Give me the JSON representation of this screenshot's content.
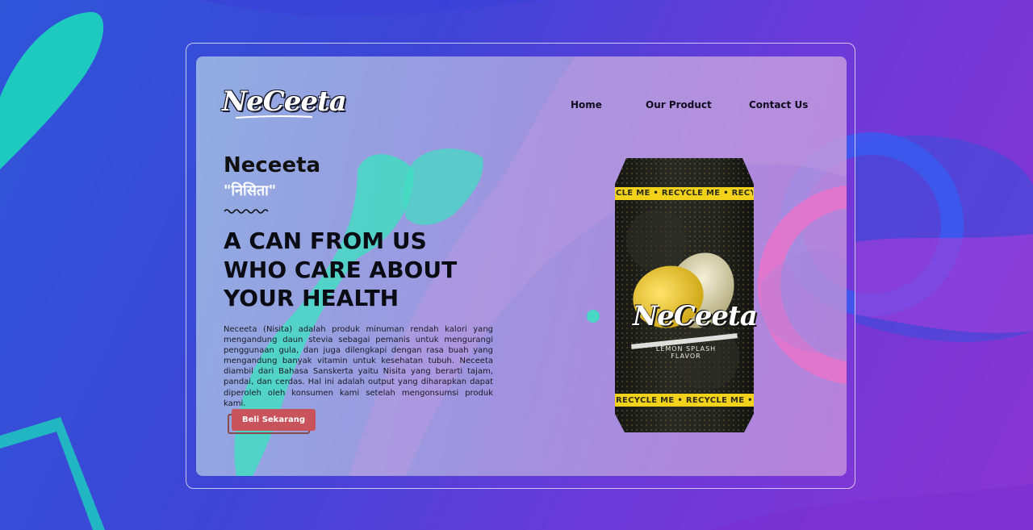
{
  "logo": {
    "text": "NeCeeta"
  },
  "nav": {
    "items": [
      "Home",
      "Our Product",
      "Contact Us"
    ]
  },
  "hero": {
    "brand_name": "Neceeta",
    "brand_native": "\"निसिता\"",
    "headline_lines": [
      "A CAN FROM US",
      "WHO CARE ABOUT",
      "YOUR HEALTH"
    ],
    "description": "Neceeta (Nisita) adalah produk minuman rendah kalori yang mengandung daun stevia sebagai pemanis untuk mengurangi penggunaan gula, dan juga dilengkapi dengan rasa buah yang mengandung banyak vitamin untuk kesehatan tubuh. Neceeta diambil dari Bahasa Sanskerta yaitu Nisita yang berarti tajam, pandai, dan cerdas. Hal ini adalah output yang diharapkan dapat diperoleh oleh konsumen kami setelah mengonsumsi produk kami.",
    "cta_label": "Beli Sekarang"
  },
  "product": {
    "can_logo": "NeCeeta",
    "flavor": "LEMON SPLASH FLAVOR",
    "band_top": "CLE ME • RECYCLE ME • RECY",
    "band_bottom": "RECYCLE ME • RECYCLE ME • R"
  },
  "colors": {
    "accent_teal": "#3fe0c0",
    "cta_red": "#c9535a",
    "can_yellow": "#f2d21a",
    "can_dark": "#1e1e1a"
  }
}
